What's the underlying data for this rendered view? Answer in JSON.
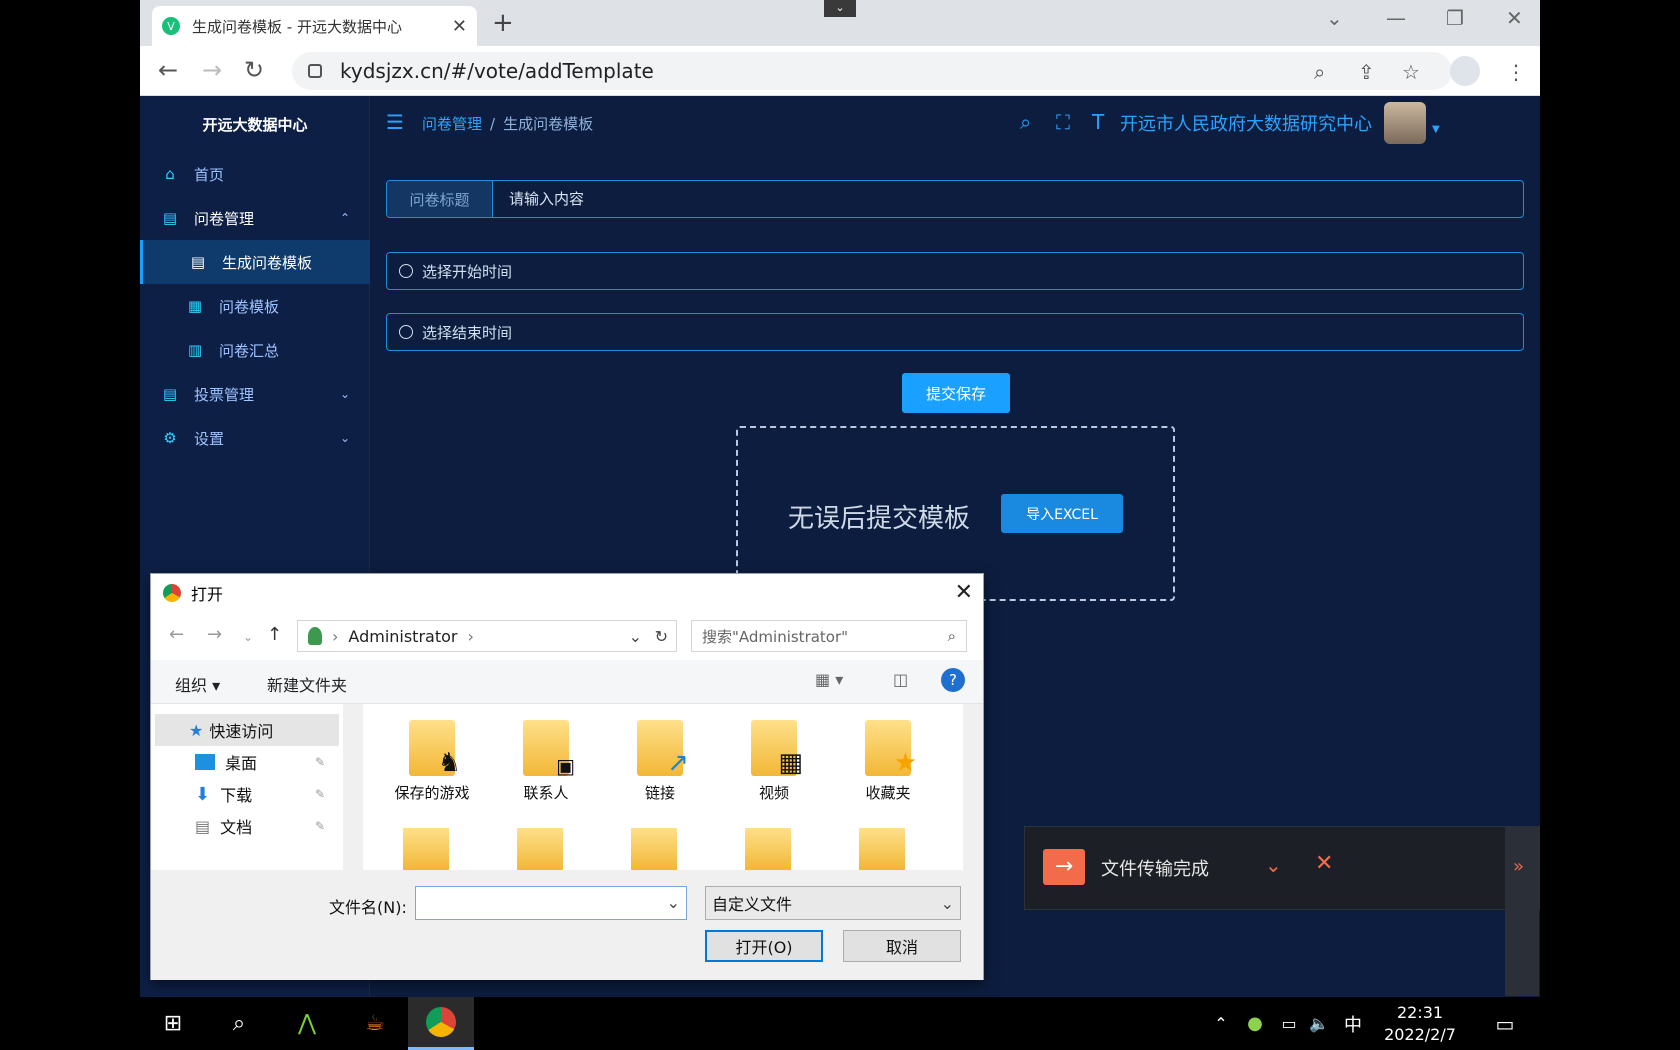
{
  "browser": {
    "tab_title": "生成问卷模板 - 开远大数据中心",
    "url": "kydsjzx.cn/#/vote/addTemplate"
  },
  "sidebar": {
    "brand": "开远大数据中心",
    "items": [
      {
        "label": "首页"
      },
      {
        "label": "问卷管理"
      },
      {
        "label": "生成问卷模板"
      },
      {
        "label": "问卷模板"
      },
      {
        "label": "问卷汇总"
      },
      {
        "label": "投票管理"
      },
      {
        "label": "设置"
      }
    ]
  },
  "topnav": {
    "breadcrumb_parent": "问卷管理",
    "breadcrumb_sep": "/",
    "breadcrumb_current": "生成问卷模板",
    "org_name": "开远市人民政府大数据研究中心"
  },
  "form": {
    "title_label": "问卷标题",
    "title_placeholder": "请输入内容",
    "start_placeholder": "选择开始时间",
    "end_placeholder": "选择结束时间",
    "save_label": "提交保存",
    "upload_text": "无误后提交模板",
    "import_label": "导入EXCEL"
  },
  "dialog": {
    "title": "打开",
    "path": "Administrator",
    "search_placeholder": "搜索\"Administrator\"",
    "organize": "组织 ▾",
    "new_folder": "新建文件夹",
    "quick_access": [
      {
        "label": "快速访问"
      },
      {
        "label": "桌面"
      },
      {
        "label": "下载"
      },
      {
        "label": "文档"
      }
    ],
    "folders": [
      {
        "label": "保存的游戏"
      },
      {
        "label": "联系人"
      },
      {
        "label": "链接"
      },
      {
        "label": "视频"
      },
      {
        "label": "收藏夹"
      }
    ],
    "filename_label": "文件名(N):",
    "filetype": "自定义文件",
    "open_label": "打开(O)",
    "cancel_label": "取消"
  },
  "toast": {
    "text": "文件传输完成"
  },
  "taskbar": {
    "time": "22:31",
    "date": "2022/2/7",
    "ime": "中"
  }
}
